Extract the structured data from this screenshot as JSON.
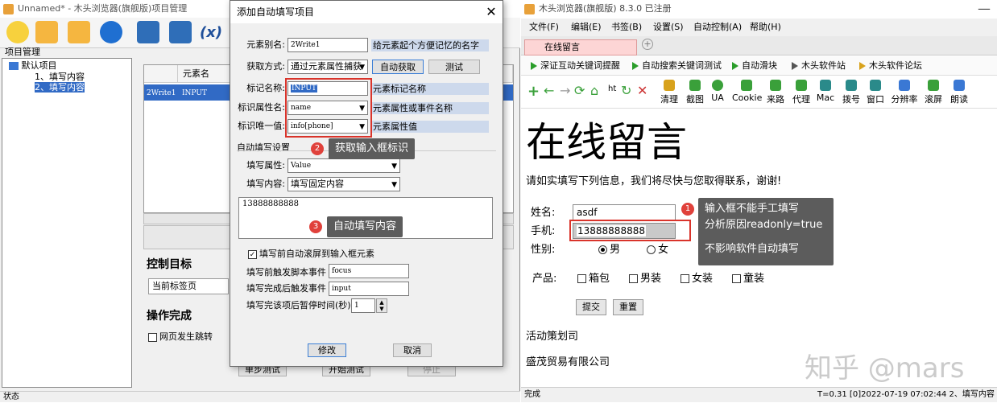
{
  "left_app": {
    "title": "Unnamed* - 木头浏览器(旗舰版)项目管理",
    "project_panel_label": "项目管理",
    "tree": [
      "默认项目",
      "1、填写内容",
      "2、填写内容"
    ],
    "grid": {
      "col_header": "元素名",
      "row_name": "2Write1",
      "row_value": "INPUT"
    },
    "control_target_label": "控制目标",
    "control_target_value": "当前标签页",
    "op_done_label": "操作完成",
    "page_jump_label": "网页发生跳转",
    "step_test_button": "单步测试",
    "start_test_button": "开始测试",
    "stop_button": "停止",
    "status": "状态"
  },
  "dialog": {
    "title": "添加自动填写项目",
    "alias_label": "元素别名:",
    "alias_value": "2Write1",
    "alias_hint": "给元素起个方便记忆的名字",
    "method_label": "获取方式:",
    "method_value": "通过元素属性捕获",
    "auto_get_button": "自动获取",
    "test_button": "测试",
    "tag_label": "标记名称:",
    "tag_value": "INPUT",
    "tag_hint": "元素标记名称",
    "attr_label": "标识属性名:",
    "attr_value": "name",
    "attr_hint": "元素属性或事件名称",
    "unique_label": "标识唯一值:",
    "unique_value": "info[phone]",
    "unique_hint": "元素属性值",
    "fill_settings_label": "自动填写设置",
    "fill_attr_label": "填写属性:",
    "fill_attr_value": "Value",
    "fill_content_label": "填写内容:",
    "fill_content_value": "填写固定内容",
    "fill_text": "13888888888",
    "scroll_check_label": "填写前自动滚屏到输入框元素",
    "before_event_label": "填写前触发脚本事件",
    "before_event_value": "focus",
    "after_event_label": "填写完成后触发事件",
    "after_event_value": "input",
    "pause_label": "填写完该项后暂停时间(秒)",
    "pause_value": "1",
    "modify_button": "修改",
    "cancel_button": "取消"
  },
  "callouts": {
    "c1_num": "1",
    "c1_line1": "输入框不能手工填写",
    "c1_line2": "分析原因readonly=true",
    "c1_line3": "不影响软件自动填写",
    "c2_num": "2",
    "c2_text": "获取输入框标识",
    "c3_num": "3",
    "c3_text": "自动填写内容"
  },
  "browser": {
    "title": "木头浏览器(旗舰版) 8.3.0  已注册",
    "menu": [
      "文件(F)",
      "编辑(E)",
      "书签(B)",
      "设置(S)",
      "自动控制(A)",
      "帮助(H)"
    ],
    "tab_label": "在线留言",
    "tab_plus": "+",
    "bookmarks": [
      "深证互动关键词提醒",
      "自动搜索关键词测试",
      "自动滑块",
      "木头软件站",
      "木头软件论坛"
    ],
    "tools": [
      "清理",
      "截图",
      "UA",
      "Cookie",
      "来路",
      "代理",
      "Mac",
      "拨号",
      "窗口",
      "分辨率",
      "滚屏",
      "朗读"
    ],
    "nav_text": "ht",
    "page": {
      "heading": "在线留言",
      "intro": "请如实填写下列信息，我们将尽快与您取得联系，谢谢!",
      "name_label": "姓名:",
      "name_value": "asdf",
      "phone_label": "手机:",
      "phone_value": "13888888888",
      "gender_label": "性别:",
      "male": "男",
      "female": "女",
      "product_label": "产品:",
      "products": [
        "箱包",
        "男装",
        "女装",
        "童装"
      ],
      "submit_button": "提交",
      "reset_button": "重置",
      "footer1": "活动策划司",
      "footer2": "盛茂贸易有限公司"
    },
    "status_left": "完成",
    "status_right": "T=0.31  [0]2022-07-19 07:02:44 2、填写内容"
  },
  "watermark": "知乎 @mars",
  "colors": {
    "red": "#d9342b",
    "callout_bg": "#5c5c5c",
    "hint_bg": "#cdd9ec",
    "tab_bg": "#fdd5d5"
  }
}
